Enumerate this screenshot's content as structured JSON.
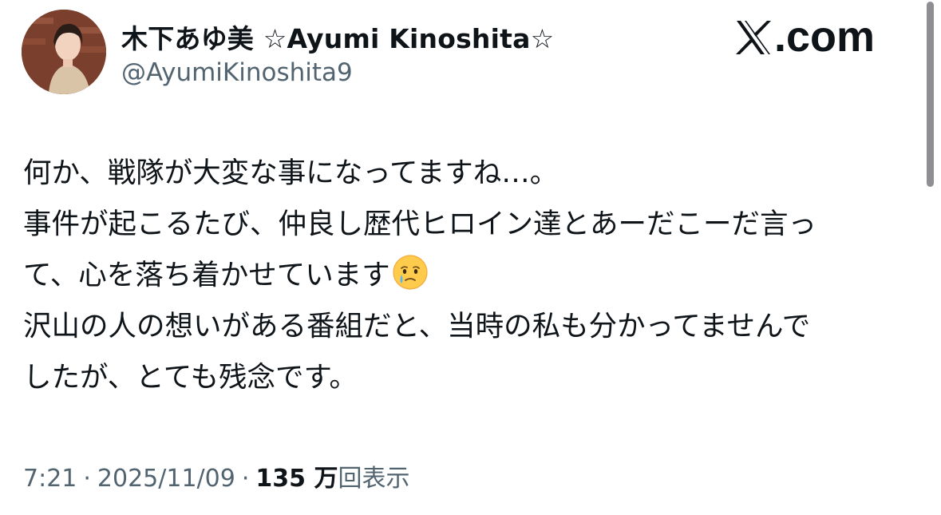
{
  "author": {
    "display_name": "木下あゆ美 ☆Ayumi Kinoshita☆",
    "handle": "@AyumiKinoshita9"
  },
  "site": {
    "logo_text": ".com",
    "logo_mark": "x-logo-icon"
  },
  "tweet": {
    "lines": [
      "何か、戦隊が大変な事になってますね…。",
      "事件が起こるたび、仲良し歴代ヒロイン達とあーだこーだ言っ",
      "て、心を落ち着かせています",
      "沢山の人の想いがある番組だと、当時の私も分かってませんで",
      "したが、とても残念です。"
    ],
    "emoji": "face-holding-back-tears-icon"
  },
  "meta": {
    "time": "7:21",
    "separator": "·",
    "date": "2025/11/09",
    "views_count": "135 万",
    "views_label": "回表示"
  },
  "colors": {
    "text_primary": "#0f1419",
    "text_secondary": "#536471",
    "background": "#ffffff",
    "scrollbar": "#8e8e93"
  }
}
